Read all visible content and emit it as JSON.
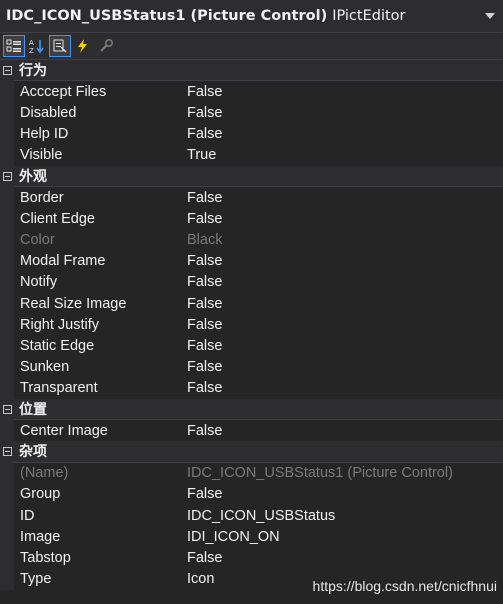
{
  "header": {
    "title": "IDC_ICON_USBStatus1 (Picture Control)",
    "kind": "IPictEditor"
  },
  "toolbar": {
    "buttons": [
      "categorized-icon",
      "alphabetical-icon",
      "properties-icon",
      "events-icon",
      "messages-icon"
    ]
  },
  "categories": [
    {
      "label": "行为",
      "props": [
        {
          "name": "Acccept Files",
          "value": "False"
        },
        {
          "name": "Disabled",
          "value": "False"
        },
        {
          "name": "Help ID",
          "value": "False"
        },
        {
          "name": "Visible",
          "value": "True"
        }
      ]
    },
    {
      "label": "外观",
      "props": [
        {
          "name": "Border",
          "value": "False"
        },
        {
          "name": "Client Edge",
          "value": "False"
        },
        {
          "name": "Color",
          "value": "Black",
          "disabled": true
        },
        {
          "name": "Modal Frame",
          "value": "False"
        },
        {
          "name": "Notify",
          "value": "False"
        },
        {
          "name": "Real Size Image",
          "value": "False"
        },
        {
          "name": "Right Justify",
          "value": "False"
        },
        {
          "name": "Static Edge",
          "value": "False"
        },
        {
          "name": "Sunken",
          "value": "False"
        },
        {
          "name": "Transparent",
          "value": "False"
        }
      ]
    },
    {
      "label": "位置",
      "props": [
        {
          "name": "Center Image",
          "value": "False"
        }
      ]
    },
    {
      "label": "杂项",
      "props": [
        {
          "name": "(Name)",
          "value": "IDC_ICON_USBStatus1 (Picture Control)",
          "disabled": true
        },
        {
          "name": "Group",
          "value": "False"
        },
        {
          "name": "ID",
          "value": "IDC_ICON_USBStatus"
        },
        {
          "name": "Image",
          "value": "IDI_ICON_ON"
        },
        {
          "name": "Tabstop",
          "value": "False"
        },
        {
          "name": "Type",
          "value": "Icon"
        }
      ]
    }
  ],
  "watermark": "https://blog.csdn.net/cnicfhnui",
  "colors": {
    "background": "#252526",
    "text": "#f1f1f1",
    "disabled_text": "#7a7a7a",
    "accent": "#3399ff"
  }
}
